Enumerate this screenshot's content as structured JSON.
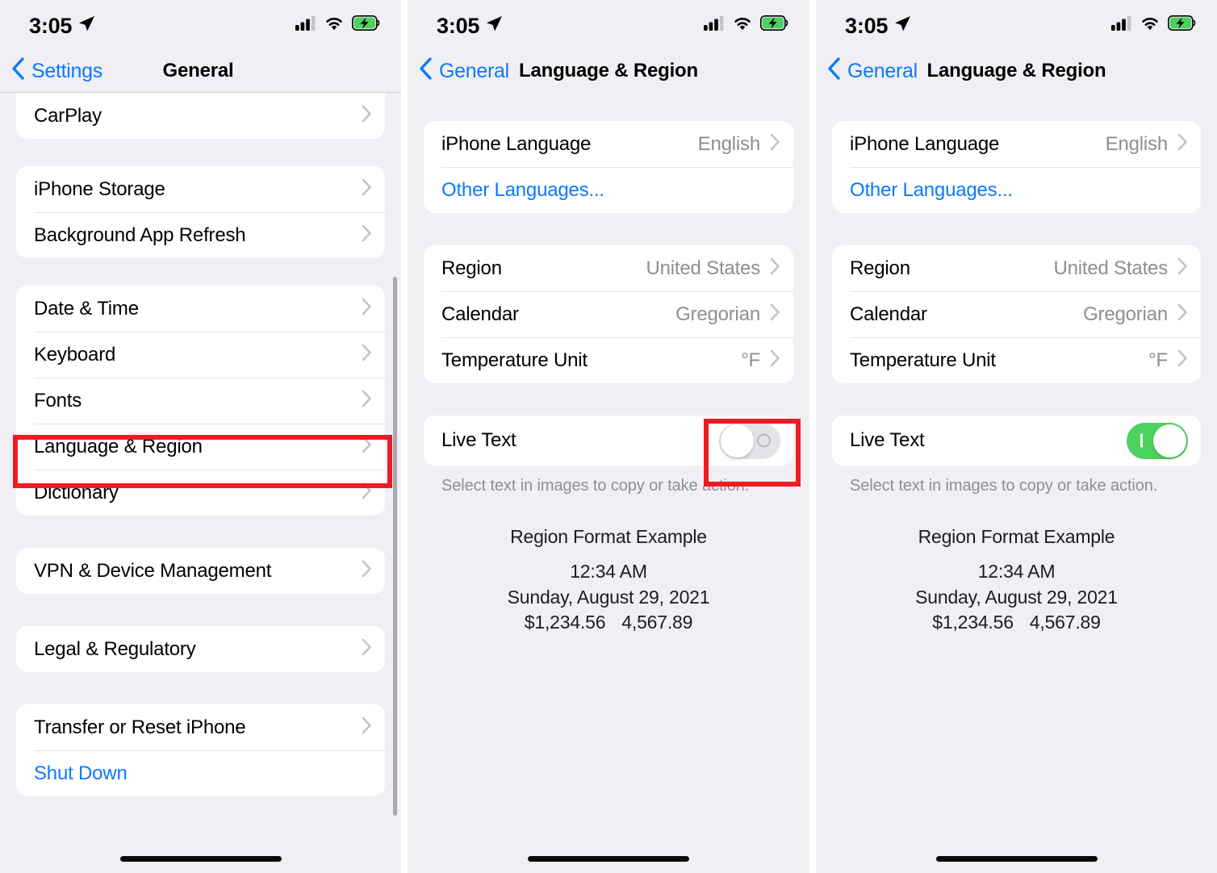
{
  "status_bar": {
    "time": "3:05",
    "location_icon": "location-arrow-icon",
    "cellular_icon": "cellular-signal-icon",
    "wifi_icon": "wifi-icon",
    "battery_icon": "battery-charging-icon",
    "battery_color": "#4cd25f"
  },
  "colors": {
    "accent_blue": "#0a7aff",
    "highlight_red": "#ee1b22",
    "toggle_on_green": "#4cd25f",
    "secondary_text": "#8e8e93",
    "page_background": "#f0eff4",
    "card_background": "#ffffff"
  },
  "panel1": {
    "nav": {
      "back_label": "Settings",
      "title": "General"
    },
    "groups": [
      {
        "rows": [
          {
            "label": "CarPlay",
            "type": "disclosure"
          }
        ]
      },
      {
        "rows": [
          {
            "label": "iPhone Storage",
            "type": "disclosure"
          },
          {
            "label": "Background App Refresh",
            "type": "disclosure"
          }
        ]
      },
      {
        "rows": [
          {
            "label": "Date & Time",
            "type": "disclosure"
          },
          {
            "label": "Keyboard",
            "type": "disclosure"
          },
          {
            "label": "Fonts",
            "type": "disclosure"
          },
          {
            "label": "Language & Region",
            "type": "disclosure",
            "highlighted": true
          },
          {
            "label": "Dictionary",
            "type": "disclosure"
          }
        ]
      },
      {
        "rows": [
          {
            "label": "VPN & Device Management",
            "type": "disclosure"
          }
        ]
      },
      {
        "rows": [
          {
            "label": "Legal & Regulatory",
            "type": "disclosure"
          }
        ]
      },
      {
        "rows": [
          {
            "label": "Transfer or Reset iPhone",
            "type": "disclosure"
          },
          {
            "label": "Shut Down",
            "type": "action",
            "style": "blue"
          }
        ]
      }
    ]
  },
  "panel2": {
    "nav": {
      "back_label": "General",
      "title": "Language & Region"
    },
    "language_group": [
      {
        "label": "iPhone Language",
        "value": "English",
        "type": "disclosure"
      },
      {
        "label": "Other Languages...",
        "type": "action",
        "style": "blue"
      }
    ],
    "region_group": [
      {
        "label": "Region",
        "value": "United States",
        "type": "disclosure"
      },
      {
        "label": "Calendar",
        "value": "Gregorian",
        "type": "disclosure"
      },
      {
        "label": "Temperature Unit",
        "value": "°F",
        "type": "disclosure"
      }
    ],
    "live_text": {
      "label": "Live Text",
      "state": "off",
      "caption": "Select text in images to copy or take action."
    },
    "format_example": {
      "title": "Region Format Example",
      "time": "12:34 AM",
      "date": "Sunday, August 29, 2021",
      "currency": "$1,234.56",
      "number": "4,567.89"
    }
  },
  "panel3": {
    "nav": {
      "back_label": "General",
      "title": "Language & Region"
    },
    "language_group": [
      {
        "label": "iPhone Language",
        "value": "English",
        "type": "disclosure"
      },
      {
        "label": "Other Languages...",
        "type": "action",
        "style": "blue"
      }
    ],
    "region_group": [
      {
        "label": "Region",
        "value": "United States",
        "type": "disclosure"
      },
      {
        "label": "Calendar",
        "value": "Gregorian",
        "type": "disclosure"
      },
      {
        "label": "Temperature Unit",
        "value": "°F",
        "type": "disclosure"
      }
    ],
    "live_text": {
      "label": "Live Text",
      "state": "on",
      "caption": "Select text in images to copy or take action."
    },
    "format_example": {
      "title": "Region Format Example",
      "time": "12:34 AM",
      "date": "Sunday, August 29, 2021",
      "currency": "$1,234.56",
      "number": "4,567.89"
    }
  }
}
